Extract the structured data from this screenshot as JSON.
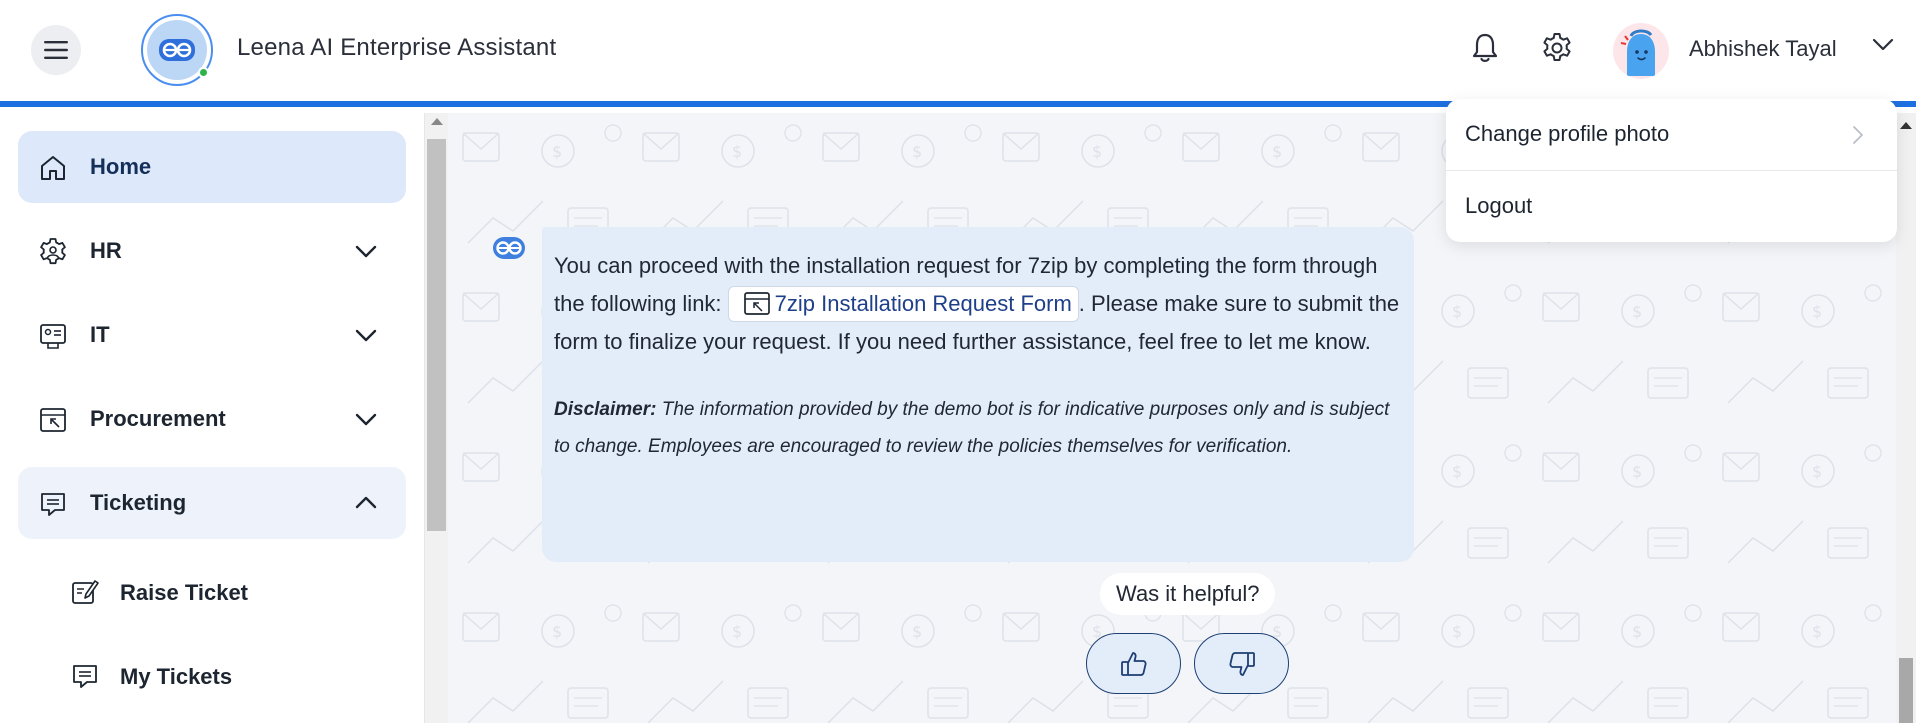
{
  "header": {
    "app_title": "Leena AI Enterprise Assistant",
    "user_name": "Abhishek Tayal",
    "icons": [
      "hamburger-menu-icon",
      "bell-icon",
      "gear-icon",
      "chevron-down-icon"
    ]
  },
  "user_menu": {
    "items": [
      {
        "label": "Change profile photo",
        "icon": "chevron-right-icon"
      },
      {
        "label": "Logout"
      }
    ]
  },
  "sidebar": {
    "items": [
      {
        "label": "Home",
        "icon": "home-icon",
        "state": "active"
      },
      {
        "label": "HR",
        "icon": "gear-user-icon",
        "state": "collapsed"
      },
      {
        "label": "IT",
        "icon": "it-id-card-icon",
        "state": "collapsed"
      },
      {
        "label": "Procurement",
        "icon": "procurement-window-icon",
        "state": "collapsed"
      },
      {
        "label": "Ticketing",
        "icon": "ticket-chat-icon",
        "state": "expanded"
      }
    ],
    "sub_items": [
      {
        "label": "Raise Ticket",
        "icon": "edit-ticket-icon"
      },
      {
        "label": "My Tickets",
        "icon": "ticket-chat-icon"
      }
    ]
  },
  "chat": {
    "message": {
      "text_before_link": "You can proceed with the installation request for 7zip by completing the form through the following link: ",
      "link_label": "7zip Installation Request Form",
      "text_after_link": ". Please make sure to submit the form to finalize your request. If you need further assistance, feel free to let me know.",
      "disclaimer_label": "Disclaimer:",
      "disclaimer_text": " The information provided by the demo bot is for indicative purposes only and is subject to change. Employees are encouraged to review the policies themselves for verification."
    },
    "feedback": {
      "question": "Was it helpful?",
      "up_icon": "thumbs-up-icon",
      "down_icon": "thumbs-down-icon"
    }
  },
  "colors": {
    "accent": "#1e6fe0",
    "bubble": "#e3edfa",
    "active_nav": "#dde9fb",
    "online": "#2db34a"
  }
}
